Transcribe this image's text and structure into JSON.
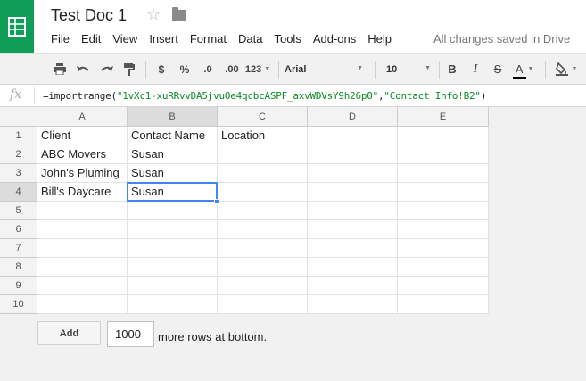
{
  "doc": {
    "title": "Test Doc 1",
    "saved_status": "All changes saved in Drive"
  },
  "menu": [
    "File",
    "Edit",
    "View",
    "Insert",
    "Format",
    "Data",
    "Tools",
    "Add-ons",
    "Help"
  ],
  "toolbar": {
    "currency": "$",
    "percent": "%",
    "decrease_decimals": ".0",
    "increase_decimals": ".00",
    "more_formats": "123",
    "font": "Arial",
    "font_size": "10",
    "bold": "B",
    "italic": "I",
    "strikethrough": "S",
    "text_color_label": "A"
  },
  "formula_bar": {
    "fx": "fx",
    "prefix": "=importrange(",
    "arg1": "\"1vXc1-xuRRvvDA5jvuOe4qcbcASPF_axvWDVsY9h26p0\"",
    "comma": ",",
    "arg2": "\"Contact Info!B2\"",
    "suffix": ")"
  },
  "sheet": {
    "columns": [
      "A",
      "B",
      "C",
      "D",
      "E"
    ],
    "rows": [
      "1",
      "2",
      "3",
      "4",
      "5",
      "6",
      "7",
      "8",
      "9",
      "10"
    ],
    "cells": [
      [
        "Client",
        "Contact Name",
        "Location",
        "",
        ""
      ],
      [
        "ABC Movers",
        "Susan",
        "",
        "",
        ""
      ],
      [
        "John's Pluming",
        "Susan",
        "",
        "",
        ""
      ],
      [
        "Bill's Daycare",
        "Susan",
        "",
        "",
        ""
      ]
    ],
    "active_cell": "B4"
  },
  "footer": {
    "add_label": "Add",
    "rows_value": "1000",
    "more_text": "more rows at bottom."
  },
  "colors": {
    "brand_green": "#0f9d58",
    "selection_blue": "#4285f4",
    "formula_string_green": "#0d8a2b"
  }
}
